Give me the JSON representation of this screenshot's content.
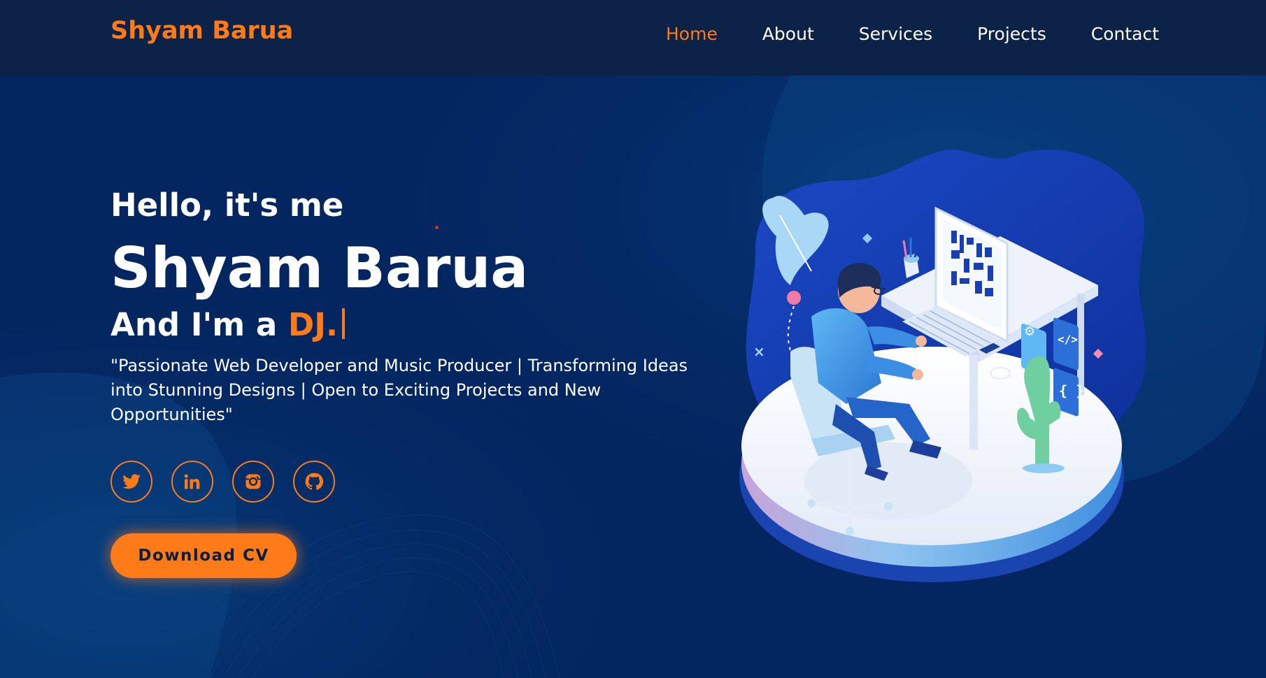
{
  "header": {
    "logo": "Shyam Barua",
    "nav": [
      {
        "label": "Home",
        "active": true
      },
      {
        "label": "About",
        "active": false
      },
      {
        "label": "Services",
        "active": false
      },
      {
        "label": "Projects",
        "active": false
      },
      {
        "label": "Contact",
        "active": false
      }
    ]
  },
  "hero": {
    "greeting": "Hello, it's me",
    "name": "Shyam Barua",
    "role_prefix": "And I'm a ",
    "role_highlight": "DJ.",
    "description": "\"Passionate Web Developer and Music Producer | Transforming Ideas into Stunning Designs | Open to Exciting Projects and New Opportunities\"",
    "socials": [
      {
        "icon": "twitter-icon"
      },
      {
        "icon": "linkedin-icon"
      },
      {
        "icon": "instagram-icon"
      },
      {
        "icon": "github-icon"
      }
    ],
    "cta_label": "Download CV"
  },
  "colors": {
    "accent": "#ff7a18",
    "navbar_bg": "#0c2247",
    "page_bg": "#032660",
    "text": "#ffffff"
  }
}
